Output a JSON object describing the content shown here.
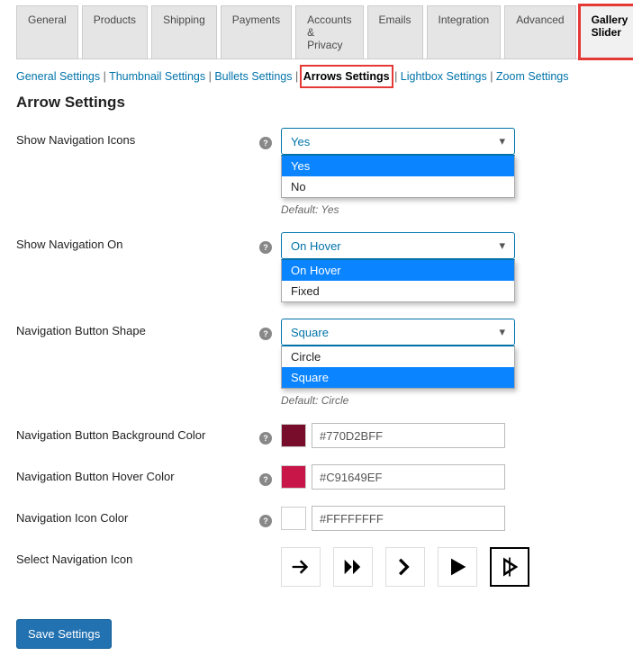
{
  "tabs": [
    {
      "label": "General"
    },
    {
      "label": "Products"
    },
    {
      "label": "Shipping"
    },
    {
      "label": "Payments"
    },
    {
      "label": "Accounts & Privacy"
    },
    {
      "label": "Emails"
    },
    {
      "label": "Integration"
    },
    {
      "label": "Advanced"
    },
    {
      "label": "Gallery Slider",
      "active": true,
      "highlight": true
    }
  ],
  "sublinks": [
    {
      "label": "General Settings"
    },
    {
      "label": "Thumbnail Settings"
    },
    {
      "label": "Bullets Settings"
    },
    {
      "label": "Arrows Settings",
      "active": true,
      "highlight": true
    },
    {
      "label": "Lightbox Settings"
    },
    {
      "label": "Zoom Settings"
    }
  ],
  "section_title": "Arrow Settings",
  "fields": {
    "show_nav_icons": {
      "label": "Show Navigation Icons",
      "selected": "Yes",
      "options": [
        "Yes",
        "No"
      ],
      "default_note": "Default: Yes"
    },
    "show_nav_on": {
      "label": "Show Navigation On",
      "selected": "On Hover",
      "options": [
        "On Hover",
        "Fixed"
      ]
    },
    "nav_btn_shape": {
      "label": "Navigation Button Shape",
      "selected": "Square",
      "options": [
        "Circle",
        "Square"
      ],
      "default_note": "Default: Circle"
    },
    "nav_btn_bg": {
      "label": "Navigation Button Background Color",
      "value": "#770D2BFF",
      "swatch": "#770d2b"
    },
    "nav_btn_hover": {
      "label": "Navigation Button Hover Color",
      "value": "#C91649EF",
      "swatch": "#c91649"
    },
    "nav_icon_color": {
      "label": "Navigation Icon Color",
      "value": "#FFFFFFFF",
      "swatch": "#ffffff"
    },
    "select_icon": {
      "label": "Select Navigation Icon",
      "icons": [
        "arrow-simple",
        "arrow-double",
        "arrow-chevron",
        "arrow-play",
        "arrow-tri-outline"
      ],
      "selected": "arrow-tri-outline"
    }
  },
  "save_label": "Save Settings"
}
